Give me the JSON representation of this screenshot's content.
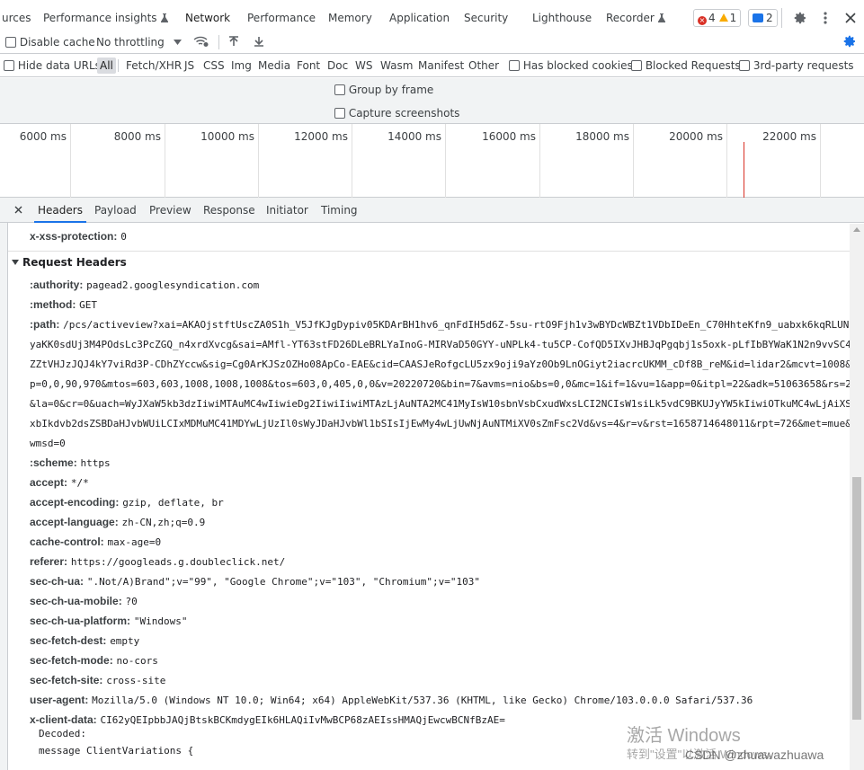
{
  "tabs": [
    {
      "label": "urces"
    },
    {
      "label": "Performance insights"
    },
    {
      "label": "Network"
    },
    {
      "label": "Performance"
    },
    {
      "label": "Memory"
    },
    {
      "label": "Application"
    },
    {
      "label": "Security"
    },
    {
      "label": "Lighthouse"
    },
    {
      "label": "Recorder"
    }
  ],
  "badges": {
    "errors": "4",
    "warnings": "1",
    "messages": "2"
  },
  "toolbar": {
    "disable_cache": "Disable cache",
    "throttling": "No throttling"
  },
  "filters": {
    "hide_data_urls": "Hide data URLs",
    "types": [
      "All",
      "Fetch/XHR",
      "JS",
      "CSS",
      "Img",
      "Media",
      "Font",
      "Doc",
      "WS",
      "Wasm",
      "Manifest",
      "Other"
    ],
    "has_blocked_cookies": "Has blocked cookies",
    "blocked_requests": "Blocked Requests",
    "third_party": "3rd-party requests"
  },
  "options": {
    "group_by_frame": "Group by frame",
    "capture_screenshots": "Capture screenshots"
  },
  "timeline": {
    "ticks": [
      "6000 ms",
      "8000 ms",
      "10000 ms",
      "12000 ms",
      "14000 ms",
      "16000 ms",
      "18000 ms",
      "20000 ms",
      "22000 ms"
    ]
  },
  "detail_tabs": [
    "Headers",
    "Payload",
    "Preview",
    "Response",
    "Initiator",
    "Timing"
  ],
  "headers": {
    "pre_row": {
      "name": "x-xss-protection:",
      "value": "0"
    },
    "section_title": "Request Headers",
    "rows": [
      {
        "name": ":authority:",
        "value": "pagead2.googlesyndication.com"
      },
      {
        "name": ":method:",
        "value": "GET"
      },
      {
        "name": ":path:",
        "value": "/pcs/activeview?xai=AKAOjstftUscZA0S1h_V5JfKJgDypiv05KDArBH1hv6_qnFdIH5d6Z-5su-rtO9Fjh1v3wBYDcWBZt1VDbIDeEn_C70HhteKfn9_uabxk6kqRLUN"
      },
      {
        "name": "",
        "value": "yaKK0sdUj3M4POdsLc3PcZGQ_n4xrdXvcg&sai=AMfl-YT63stFD26DLeBRLYaInoG-MIRVaD50GYY-uNPLk4-tu5CP-CofQD5IXvJHBJqPgqbj1s5oxk-pLfIbBYWaK1N2n9vvSC4"
      },
      {
        "name": "",
        "value": "ZZtVHJzJQJ4kY7viRd3P-CDhZYccw&sig=Cg0ArKJSzOZHo08ApCo-EAE&cid=CAASJeRofgcLU5zx9oji9aYz0Ob9LnOGiyt2iacrcUKMM_cDf8B_reM&id=lidar2&mcvt=1008&"
      },
      {
        "name": "",
        "value": "p=0,0,90,970&mtos=603,603,1008,1008,1008&tos=603,0,405,0,0&v=20220720&bin=7&avms=nio&bs=0,0&mc=1&if=1&vu=1&app=0&itpl=22&adk=51063658&rs=2"
      },
      {
        "name": "",
        "value": "&la=0&cr=0&uach=WyJXaW5kb3dzIiwiMTAuMC4wIiwieDg2IiwiIiwiMTAzLjAuNTA2MC41MyIsW10sbnVsbCxudWxsLCI2NCIsW1siLk5vdC9BKUJyYW5kIiwiOTkuMC4wLjAiXS"
      },
      {
        "name": "",
        "value": "xbIkdvb2dsZSBDaHJvbWUiLCIxMDMuMC41MDYwLjUzIl0sWyJDaHJvbWl1bSIsIjEwMy4wLjUwNjAuNTMiXV0sZmFsc2Vd&vs=4&r=v&rst=1658714648011&rpt=726&met=mue&"
      },
      {
        "name": "",
        "value": "wmsd=0"
      },
      {
        "name": ":scheme:",
        "value": "https"
      },
      {
        "name": "accept:",
        "value": "*/*"
      },
      {
        "name": "accept-encoding:",
        "value": "gzip, deflate, br"
      },
      {
        "name": "accept-language:",
        "value": "zh-CN,zh;q=0.9"
      },
      {
        "name": "cache-control:",
        "value": "max-age=0"
      },
      {
        "name": "referer:",
        "value": "https://googleads.g.doubleclick.net/"
      },
      {
        "name": "sec-ch-ua:",
        "value": "\".Not/A)Brand\";v=\"99\", \"Google Chrome\";v=\"103\", \"Chromium\";v=\"103\""
      },
      {
        "name": "sec-ch-ua-mobile:",
        "value": "?0"
      },
      {
        "name": "sec-ch-ua-platform:",
        "value": "\"Windows\""
      },
      {
        "name": "sec-fetch-dest:",
        "value": "empty"
      },
      {
        "name": "sec-fetch-mode:",
        "value": "no-cors"
      },
      {
        "name": "sec-fetch-site:",
        "value": "cross-site"
      },
      {
        "name": "user-agent:",
        "value": "Mozilla/5.0 (Windows NT 10.0; Win64; x64) AppleWebKit/537.36 (KHTML, like Gecko) Chrome/103.0.0.0 Safari/537.36"
      },
      {
        "name": "x-client-data:",
        "value": "CI62yQEIpbbJAQjBtskBCKmdygEIk6HLAQiIvMwBCP68zAEIssHMAQjEwcwBCNfBzAE="
      }
    ],
    "decoded_label": "Decoded:",
    "decoded_line": "message ClientVariations {"
  },
  "watermark": {
    "line1": "激活 Windows",
    "line2": "转到\"设置\"以激活 Windows。",
    "csdn": "CSDN @zhuawazhuawa"
  },
  "colors": {
    "accent": "#1a73e8",
    "error": "#d93025",
    "warning": "#f9ab00"
  }
}
